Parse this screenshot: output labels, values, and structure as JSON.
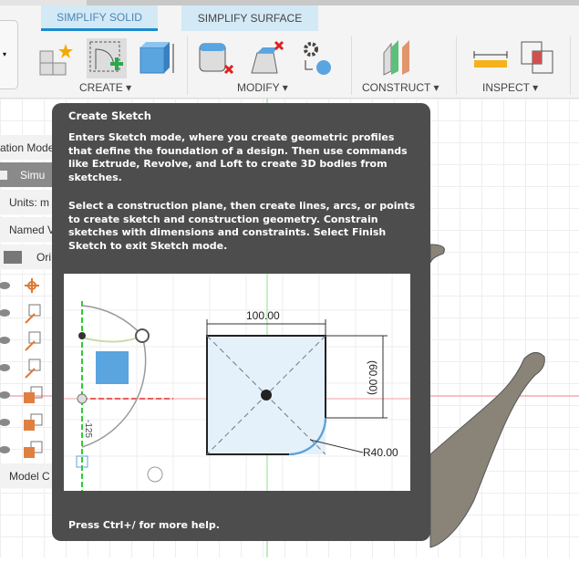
{
  "tabs": [
    {
      "label": "SIMPLIFY SOLID",
      "active": true
    },
    {
      "label": "SIMPLIFY SURFACE",
      "active": false
    }
  ],
  "groups": {
    "create": "CREATE ▾",
    "modify": "MODIFY ▾",
    "construct": "CONSTRUCT ▾",
    "inspect": "INSPECT ▾"
  },
  "sidebar": {
    "rows": [
      "ation Mode",
      "Simu",
      "Units: m",
      "Named V",
      "Ori",
      "Model C"
    ]
  },
  "tooltip": {
    "title": "Create Sketch",
    "para1": "Enters Sketch mode, where you create geometric profiles that define the foundation of a design. Then use commands like Extrude, Revolve, and Loft to create 3D bodies from sketches.",
    "para2": "Select a construction plane, then create lines, arcs, or points to create sketch and construction geometry. Constrain sketches with dimensions and constraints. Select Finish Sketch to exit Sketch mode.",
    "dims": {
      "width": "100.00",
      "height": "(60.00)",
      "radius": "R40.00",
      "angle": "-125"
    },
    "footer": "Press Ctrl+/ for more help."
  },
  "colors": {
    "accent": "#1a8ad0",
    "tooltip_bg": "#4d4d4d"
  }
}
